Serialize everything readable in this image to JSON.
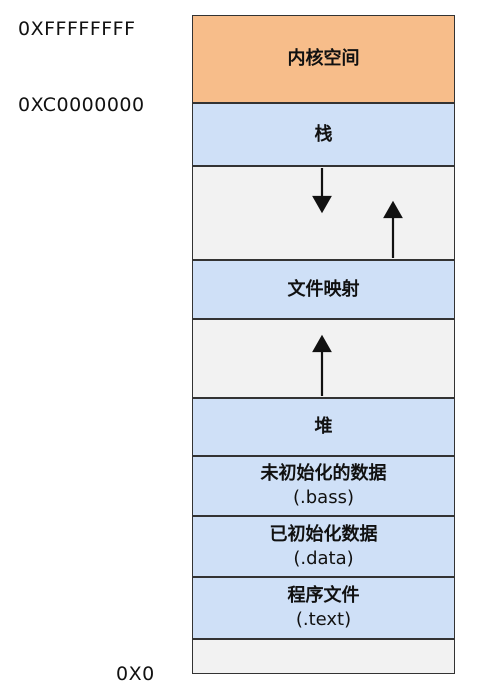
{
  "addresses": {
    "top": "0XFFFFFFFF",
    "kernel_boundary": "0XC0000000",
    "bottom": "0X0"
  },
  "segments": {
    "kernel": {
      "label": "内核空间"
    },
    "stack": {
      "label": "栈"
    },
    "mmap": {
      "label": "文件映射"
    },
    "heap": {
      "label": "堆"
    },
    "bss": {
      "label": "未初始化的数据",
      "sub": "(.bass)"
    },
    "data": {
      "label": "已初始化数据",
      "sub": "(.data)"
    },
    "text": {
      "label": "程序文件",
      "sub": "(.text)"
    }
  },
  "colors": {
    "kernel": "#f7bd8a",
    "segment": "#cfe0f7",
    "free": "#f2f2f2"
  }
}
